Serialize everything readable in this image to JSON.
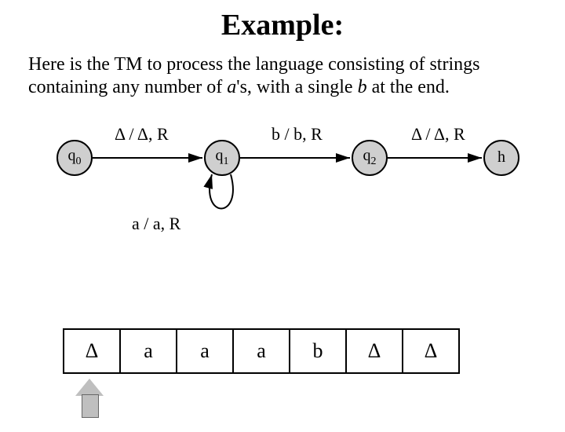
{
  "title": "Example:",
  "description": {
    "pre": "Here is the TM to process the language consisting of strings containing any number of ",
    "a": "a",
    "mid": "'s, with a single ",
    "b": "b",
    "post": " at the end."
  },
  "states": {
    "q0": "q",
    "q0_sub": "0",
    "q1": "q",
    "q1_sub": "1",
    "q2": "q",
    "q2_sub": "2",
    "h": "h"
  },
  "edges": {
    "e0": "Δ / Δ, R",
    "e1": "b / b, R",
    "e2": "Δ / Δ, R",
    "loop": "a / a, R"
  },
  "tape": [
    "Δ",
    "a",
    "a",
    "a",
    "b",
    "Δ",
    "Δ"
  ]
}
